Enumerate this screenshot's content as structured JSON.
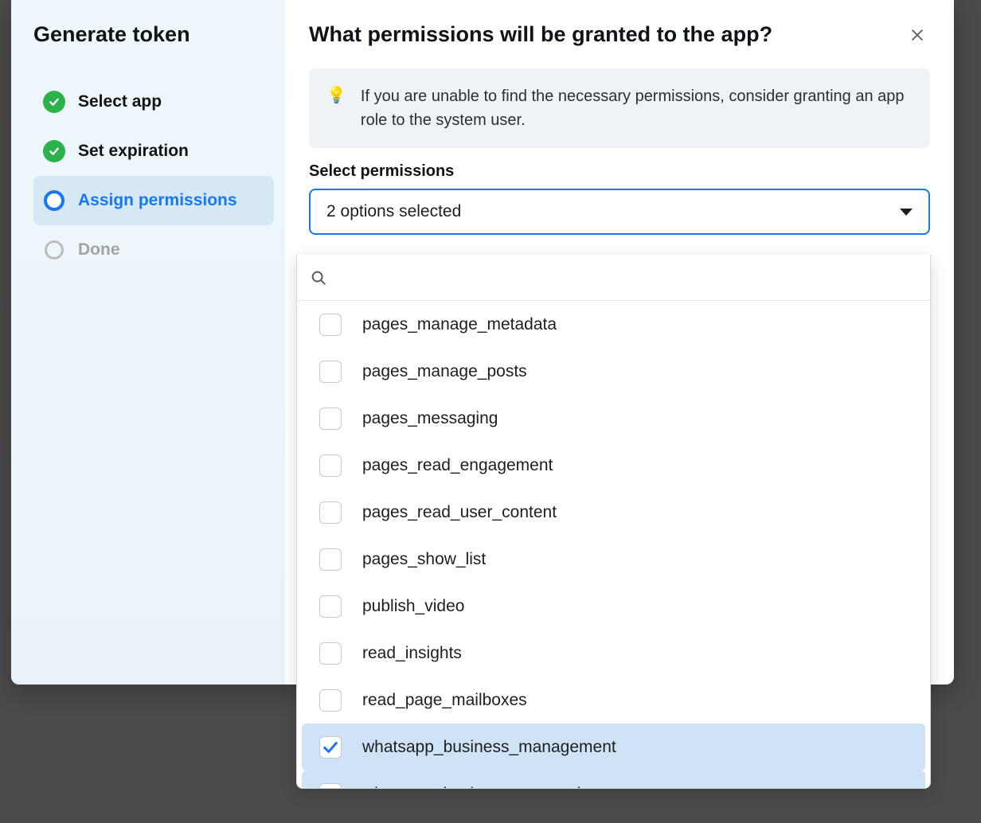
{
  "sidebar": {
    "title": "Generate token",
    "steps": [
      {
        "label": "Select app",
        "state": "complete"
      },
      {
        "label": "Set expiration",
        "state": "complete"
      },
      {
        "label": "Assign permissions",
        "state": "current"
      },
      {
        "label": "Done",
        "state": "pending"
      }
    ]
  },
  "main": {
    "title": "What permissions will be granted to the app?",
    "hint": "If you are unable to find the necessary permissions, consider granting an app role to the system user.",
    "section_label": "Select permissions",
    "select_summary": "2 options selected",
    "search_value": ""
  },
  "options": [
    {
      "label": "pages_manage_metadata",
      "checked": false
    },
    {
      "label": "pages_manage_posts",
      "checked": false
    },
    {
      "label": "pages_messaging",
      "checked": false
    },
    {
      "label": "pages_read_engagement",
      "checked": false
    },
    {
      "label": "pages_read_user_content",
      "checked": false
    },
    {
      "label": "pages_show_list",
      "checked": false
    },
    {
      "label": "publish_video",
      "checked": false
    },
    {
      "label": "read_insights",
      "checked": false
    },
    {
      "label": "read_page_mailboxes",
      "checked": false
    },
    {
      "label": "whatsapp_business_management",
      "checked": true
    },
    {
      "label": "whatsapp_business_messaging",
      "checked": true
    }
  ]
}
